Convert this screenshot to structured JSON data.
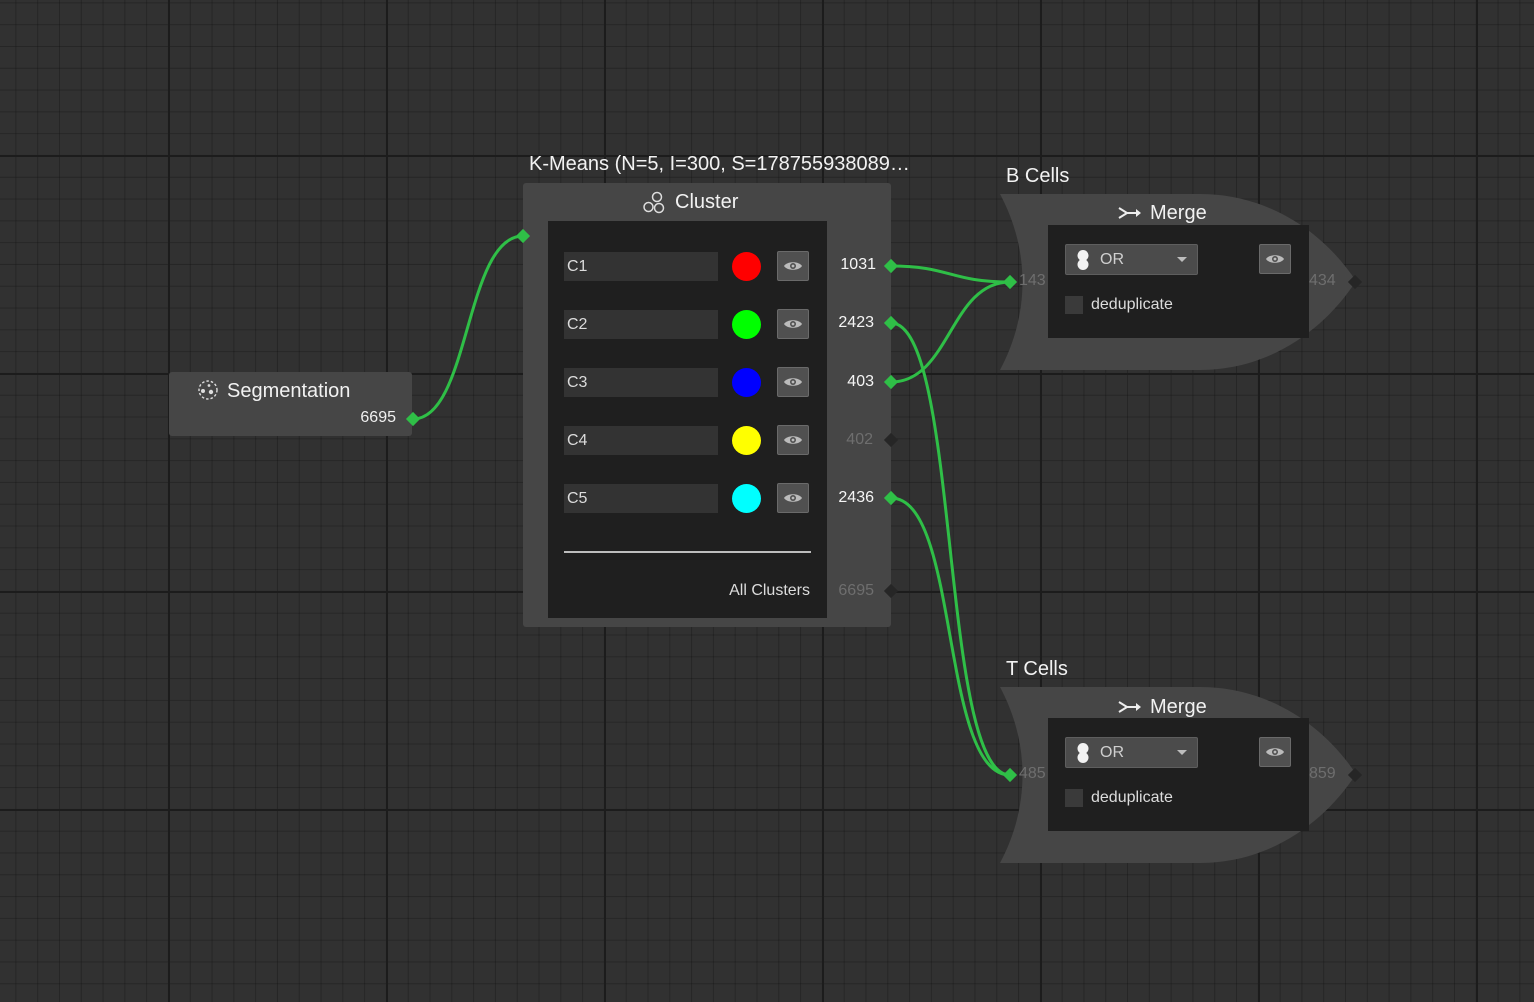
{
  "segmentation": {
    "title": "Segmentation",
    "icon": "segmentation-icon",
    "output_count": "6695"
  },
  "cluster": {
    "caption": "K-Means (N=5, I=300, S=178755938089…",
    "title": "Cluster",
    "icon": "cluster-icon",
    "rows": [
      {
        "name": "C1",
        "color": "#ff0000",
        "count": "1031",
        "connected": true
      },
      {
        "name": "C2",
        "color": "#00ff00",
        "count": "2423",
        "connected": true
      },
      {
        "name": "C3",
        "color": "#0000ff",
        "count": "403",
        "connected": true
      },
      {
        "name": "C4",
        "color": "#ffff00",
        "count": "402",
        "connected": false
      },
      {
        "name": "C5",
        "color": "#00ffff",
        "count": "2436",
        "connected": true
      }
    ],
    "all_label": "All Clusters",
    "all_count": "6695"
  },
  "merge_b": {
    "caption": "B Cells",
    "title": "Merge",
    "operator": "OR",
    "dedup_label": "deduplicate",
    "dedup_checked": false,
    "input_count": "143",
    "output_count": "434"
  },
  "merge_t": {
    "caption": "T Cells",
    "title": "Merge",
    "operator": "OR",
    "dedup_label": "deduplicate",
    "dedup_checked": false,
    "input_count": "485",
    "output_count": "859"
  },
  "colors": {
    "wire": "#2fbf47",
    "port_active": "#2fbf47",
    "port_inactive": "#262626",
    "node_bg": "#464646",
    "panel_bg": "#1f1f1f"
  }
}
